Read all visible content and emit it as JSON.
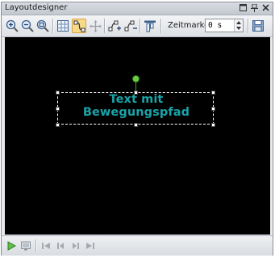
{
  "window": {
    "title": "Layoutdesigner"
  },
  "toolbar": {
    "zeit_label": "Zeitmarke:",
    "zeit_value": "0 s"
  },
  "canvas": {
    "text": "Text mit Bewegungspfad",
    "text_color": "#1aa3a8",
    "background": "#000000"
  },
  "icons": {
    "titlebar": [
      "window-menu-icon",
      "pin-icon",
      "close-icon"
    ],
    "toolbar": [
      "zoom-in-icon",
      "zoom-out-icon",
      "zoom-fit-icon",
      "grid-icon",
      "motion-path-icon",
      "move-path-icon",
      "add-node-icon",
      "remove-node-icon",
      "align-icon",
      "save-icon"
    ],
    "bottom": [
      "play-icon",
      "screen-icon",
      "first-frame-icon",
      "previous-frame-icon",
      "next-frame-icon",
      "last-frame-icon"
    ]
  }
}
